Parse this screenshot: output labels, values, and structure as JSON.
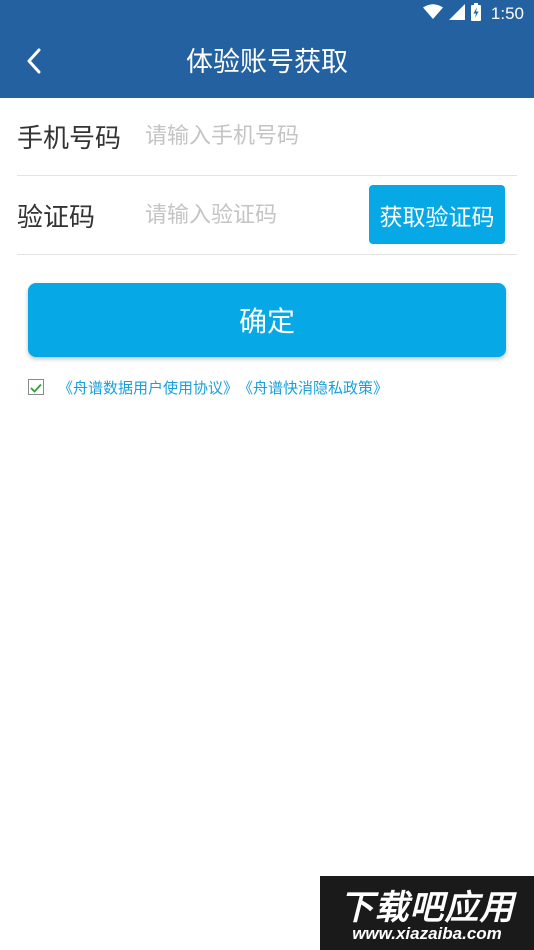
{
  "status_bar": {
    "time": "1:50",
    "icons": [
      "wifi-icon",
      "cell-signal-icon",
      "battery-charging-icon"
    ]
  },
  "app_bar": {
    "title": "体验账号获取",
    "back_icon": "chevron-left-icon",
    "background_color": "#2461a0"
  },
  "form": {
    "phone": {
      "label": "手机号码",
      "placeholder": "请输入手机号码",
      "value": ""
    },
    "code": {
      "label": "验证码",
      "placeholder": "请输入验证码",
      "value": "",
      "get_code_label": "获取验证码"
    }
  },
  "confirm": {
    "label": "确定",
    "color": "#06a8e6"
  },
  "agreement": {
    "checked": true,
    "user_agreement": "《舟谱数据用户使用协议》",
    "privacy_policy": "《舟谱快消隐私政策》",
    "link_color": "#1aa0d8"
  },
  "watermark": {
    "main": "下载吧应用",
    "sub": "www.xiazaiba.com"
  }
}
